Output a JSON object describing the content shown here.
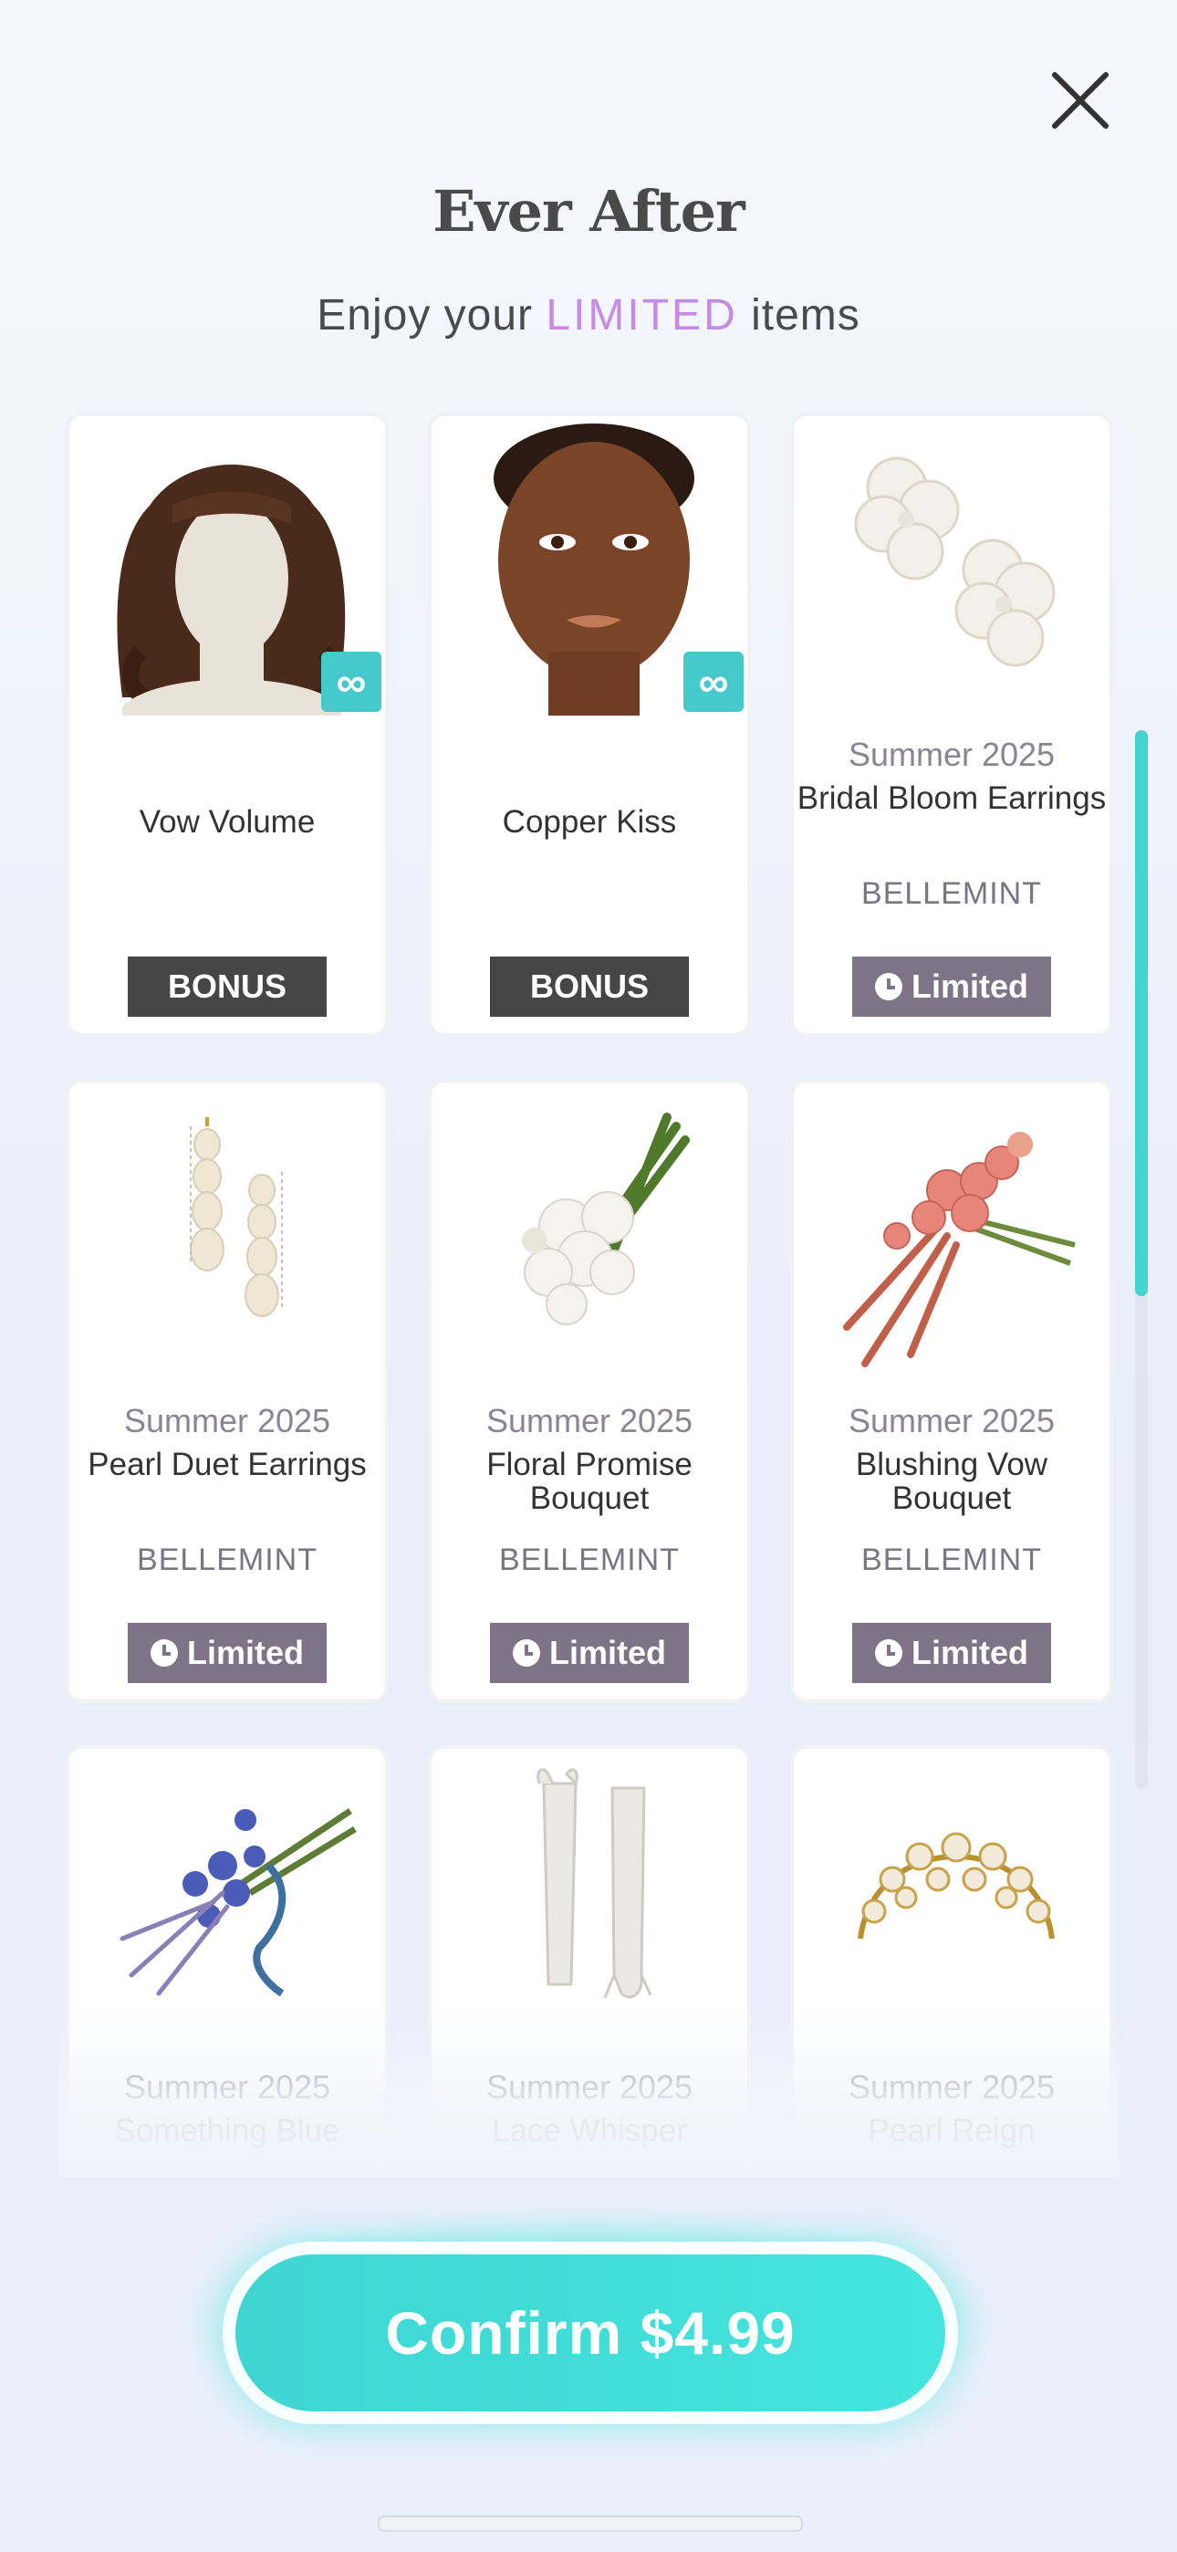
{
  "header": {
    "title": "Ever After",
    "subtitle_prefix": "Enjoy your ",
    "subtitle_highlight": "LIMITED",
    "subtitle_suffix": " items",
    "highlight_color": "#c68be6"
  },
  "items": [
    {
      "season": "",
      "name": "Vow Volume",
      "brand": "",
      "tag": "BONUS",
      "tag_type": "bonus",
      "infinite": true,
      "image": "hair-icon"
    },
    {
      "season": "",
      "name": "Copper Kiss",
      "brand": "",
      "tag": "BONUS",
      "tag_type": "bonus",
      "infinite": true,
      "image": "face-icon"
    },
    {
      "season": "Summer 2025",
      "name": "Bridal Bloom Earrings",
      "brand": "BELLEMINT",
      "tag": "Limited",
      "tag_type": "limited",
      "infinite": false,
      "image": "flower-earrings-icon"
    },
    {
      "season": "Summer 2025",
      "name": "Pearl Duet Earrings",
      "brand": "BELLEMINT",
      "tag": "Limited",
      "tag_type": "limited",
      "infinite": false,
      "image": "pearl-earrings-icon"
    },
    {
      "season": "Summer 2025",
      "name": "Floral Promise Bouquet",
      "brand": "BELLEMINT",
      "tag": "Limited",
      "tag_type": "limited",
      "infinite": false,
      "image": "white-bouquet-icon"
    },
    {
      "season": "Summer 2025",
      "name": "Blushing Vow Bouquet",
      "brand": "BELLEMINT",
      "tag": "Limited",
      "tag_type": "limited",
      "infinite": false,
      "image": "pink-bouquet-icon"
    },
    {
      "season": "Summer 2025",
      "name": "Something Blue",
      "brand": "",
      "tag": "",
      "tag_type": "",
      "infinite": false,
      "image": "blue-bouquet-icon"
    },
    {
      "season": "Summer 2025",
      "name": "Lace Whisper",
      "brand": "",
      "tag": "",
      "tag_type": "",
      "infinite": false,
      "image": "lace-gloves-icon"
    },
    {
      "season": "Summer 2025",
      "name": "Pearl Reign",
      "brand": "",
      "tag": "",
      "tag_type": "",
      "infinite": false,
      "image": "pearl-tiara-icon"
    }
  ],
  "confirm": {
    "label": "Confirm $4.99",
    "color": "#45e4de"
  },
  "colors": {
    "bonus_tag": "#464646",
    "limited_tag": "#7f7487",
    "infinite_badge": "#45c9cb"
  }
}
